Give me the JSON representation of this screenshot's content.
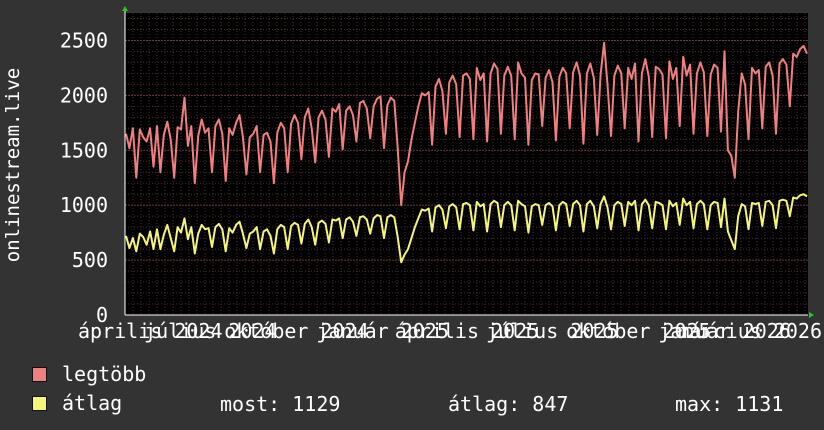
{
  "colors": {
    "background": "#333333",
    "plot_background": "#000000",
    "grid": "#4a2a2a",
    "axis": "#ffffff",
    "max_series": "#f07f7f",
    "avg_series": "#f5f57a",
    "arrow": "#22cc22"
  },
  "chart_data": {
    "type": "line",
    "ylabel": "onlinestream.live",
    "ylim": [
      0,
      2750
    ],
    "yticks": [
      0,
      500,
      1000,
      1500,
      2000,
      2500
    ],
    "x_start": "2024-04-01",
    "x_end": "2026-03-31",
    "xtick_labels": [
      "április 2024",
      "július 2024",
      "október 2024",
      "január 2025",
      "április 2025",
      "július 2025",
      "október 2025",
      "január 2026",
      "március 2026"
    ],
    "grid": true,
    "series": [
      {
        "name": "legtöbb",
        "values": [
          1650,
          1520,
          1700,
          1250,
          1690,
          1620,
          1580,
          1700,
          1350,
          1720,
          1300,
          1640,
          1760,
          1600,
          1250,
          1710,
          1690,
          1980,
          1540,
          1720,
          1200,
          1630,
          1780,
          1660,
          1700,
          1300,
          1720,
          1780,
          1650,
          1220,
          1700,
          1640,
          1750,
          1820,
          1620,
          1280,
          1620,
          1650,
          1720,
          1300,
          1640,
          1660,
          1580,
          1200,
          1660,
          1750,
          1700,
          1300,
          1740,
          1820,
          1750,
          1420,
          1800,
          1880,
          1700,
          1390,
          1800,
          1860,
          1780,
          1440,
          1880,
          1850,
          1920,
          1510,
          1860,
          1900,
          1820,
          1580,
          1930,
          1950,
          1880,
          1610,
          1900,
          1970,
          1990,
          1520,
          1910,
          1980,
          1950,
          1520,
          1000,
          1300,
          1400,
          1600,
          1750,
          1900,
          2020,
          2000,
          2030,
          1550,
          2080,
          2150,
          2040,
          1650,
          2120,
          2180,
          2100,
          1620,
          2180,
          2200,
          2150,
          1600,
          2250,
          2140,
          2200,
          1580,
          2200,
          2290,
          2240,
          1650,
          2180,
          2260,
          2180,
          1600,
          2300,
          2200,
          2160,
          1550,
          2140,
          2200,
          2190,
          1720,
          2160,
          2230,
          2120,
          1590,
          2170,
          2250,
          2200,
          1700,
          2210,
          2300,
          2180,
          1560,
          2200,
          2290,
          2160,
          1640,
          2190,
          2480,
          2100,
          1630,
          2180,
          2270,
          2200,
          1700,
          2250,
          2150,
          2290,
          1580,
          2200,
          2330,
          2170,
          1620,
          2260,
          2240,
          2190,
          1610,
          2310,
          2150,
          2250,
          1720,
          2350,
          2180,
          2280,
          1650,
          2200,
          2300,
          2210,
          1630,
          2190,
          2280,
          2250,
          1670,
          2400,
          1500,
          1450,
          1250,
          1850,
          2200,
          2100,
          1600,
          2250,
          2200,
          2230,
          1700,
          2260,
          2300,
          2180,
          1650,
          2290,
          2330,
          2280,
          1900,
          2380,
          2350,
          2420,
          2450,
          2380
        ]
      },
      {
        "name": "átlag",
        "values": [
          720,
          610,
          700,
          580,
          740,
          710,
          640,
          760,
          600,
          780,
          600,
          730,
          820,
          700,
          580,
          800,
          750,
          880,
          690,
          800,
          560,
          740,
          820,
          780,
          790,
          620,
          800,
          830,
          780,
          580,
          790,
          750,
          820,
          850,
          740,
          610,
          740,
          760,
          800,
          600,
          760,
          780,
          720,
          560,
          780,
          820,
          800,
          600,
          810,
          840,
          820,
          650,
          830,
          870,
          800,
          640,
          840,
          860,
          830,
          660,
          870,
          860,
          880,
          700,
          870,
          890,
          850,
          720,
          890,
          900,
          870,
          740,
          880,
          910,
          900,
          700,
          890,
          910,
          890,
          710,
          480,
          550,
          600,
          700,
          800,
          880,
          960,
          950,
          970,
          760,
          980,
          1000,
          960,
          790,
          990,
          1010,
          980,
          780,
          1010,
          1020,
          1000,
          770,
          1030,
          990,
          1010,
          760,
          1010,
          1040,
          1020,
          800,
          1000,
          1030,
          1000,
          770,
          1040,
          1010,
          990,
          750,
          990,
          1010,
          1000,
          820,
          1000,
          1020,
          990,
          770,
          1000,
          1030,
          1010,
          810,
          1010,
          1040,
          1000,
          760,
          1010,
          1040,
          990,
          790,
          1010,
          1080,
          980,
          780,
          1000,
          1030,
          1010,
          810,
          1030,
          1000,
          1040,
          770,
          1010,
          1050,
          1000,
          790,
          1030,
          1020,
          1000,
          780,
          1040,
          990,
          1020,
          820,
          1060,
          1000,
          1030,
          790,
          1010,
          1040,
          1010,
          780,
          1000,
          1030,
          1020,
          800,
          1060,
          760,
          680,
          600,
          900,
          1010,
          990,
          780,
          1020,
          1010,
          1020,
          810,
          1030,
          1040,
          1000,
          790,
          1040,
          1050,
          1040,
          900,
          1070,
          1060,
          1090,
          1100,
          1080
        ]
      }
    ]
  },
  "legend": {
    "max_label": "legtöbb",
    "avg_label": "átlag",
    "now_label": "most:",
    "now_value": "1129",
    "avg_stat_label": "átlag:",
    "avg_stat_value": "847",
    "max_stat_label": "max:",
    "max_stat_value": "1131"
  }
}
